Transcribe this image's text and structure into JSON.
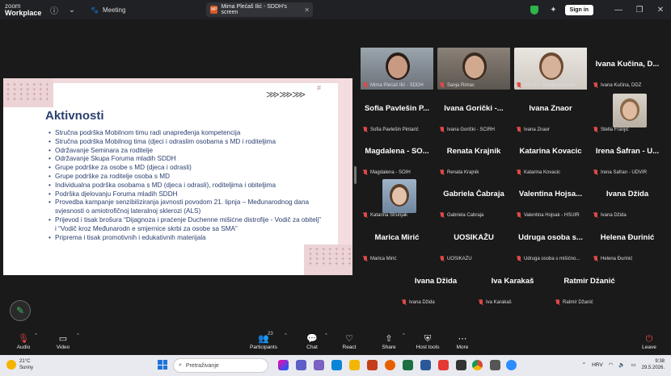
{
  "titlebar": {
    "logo_line1": "zoom",
    "logo_line2": "Workplace",
    "meeting_tab": "Meeting",
    "share_tab_badge": "MP",
    "share_tab_title": "Mima Plećaš Ilić - SDDH's screen",
    "signin": "Sign in"
  },
  "slide": {
    "title": "Aktivnosti",
    "arrows": "⋙⋙⋙",
    "items": [
      "Stručna podrška Mobilnom timu radi unapređenja kompetencija",
      "Stručna podrška Mobilnog tima (djeci i odraslim osobama s MD i roditeljima",
      "Održavanje Seminara za roditelje",
      "Održavanje Skupa Foruma mladih SDDH",
      "Grupe podrške za osobe s MD (djeca i odrasli)",
      "Grupe podrške za roditelje osoba s MD",
      "Individualna podrška osobama s MD (djeca i odrasli), roditeljima i obiteljima",
      "Podrška djelovanju Foruma mladih SDDH",
      "Provedba kampanje senzibiliziranja javnosti povodom 21. lipnja – Međunarodnog dana svjesnosti o amiotrofičnoj lateralnoj sklerozi (ALS)",
      "Prijevod i tisak brošura “Dijagnoza i praćenje Duchenne mišićne distrofije - Vodič za obitelj” i “Vodič kroz Međunarodn e smjernice skrbi za osobe sa SMA”",
      "Priprema i tisak promotivnih i edukativnih materijala"
    ]
  },
  "participants": [
    {
      "big": "",
      "caption": "Mima Plećaš Ilić - SDDH",
      "video": true
    },
    {
      "big": "",
      "caption": "Sanja Rimac",
      "video": true
    },
    {
      "big": "",
      "caption": "HSUTI - Marijana Borac",
      "video": true
    },
    {
      "big": "Ivana Kučina, D...",
      "caption": "Ivana Kučina, DDZ",
      "video": false
    },
    {
      "big": "Sofia Pavlešin P...",
      "caption": "Sofia Pavlešin Pintarić",
      "video": false
    },
    {
      "big": "Ivana Gorički -...",
      "caption": "Ivana Gorički - SCIRH",
      "video": false
    },
    {
      "big": "Ivana Znaor",
      "caption": "Ivana Znaor",
      "video": false
    },
    {
      "big": "",
      "caption": "Stella Franjić",
      "video": true
    },
    {
      "big": "Magdalena - SO...",
      "caption": "Magdalena - SOIH",
      "video": false
    },
    {
      "big": "Renata Krajnik",
      "caption": "Renata Krajnik",
      "video": false
    },
    {
      "big": "Katarina Kovacic",
      "caption": "Katarina Kovacic",
      "video": false
    },
    {
      "big": "Irena Šafran - U...",
      "caption": "Irena Šafran - UDVIR",
      "video": false
    },
    {
      "big": "",
      "caption": "Katarina Strunjak",
      "video": true
    },
    {
      "big": "Gabriela Čabraja",
      "caption": "Gabriela Čabraja",
      "video": false
    },
    {
      "big": "Valentina Hojsa...",
      "caption": "Valentina Hojsak - HSUIR",
      "video": false
    },
    {
      "big": "Ivana Džida",
      "caption": "Ivana Džida",
      "video": false
    },
    {
      "big": "Marica Mirić",
      "caption": "Marica Mirić",
      "video": false
    },
    {
      "big": "UOSIKAŽU",
      "caption": "UOSIKAŽU",
      "video": false
    },
    {
      "big": "Udruga osoba s...",
      "caption": "Udruga osoba s mišićno...",
      "video": false
    },
    {
      "big": "Helena Đurinić",
      "caption": "Helena Đurinić",
      "video": false
    },
    {
      "big": "Ivana Džida",
      "caption": "Ivana Džida",
      "video": false
    },
    {
      "big": "Iva Karakaš",
      "caption": "Iva Karakaš",
      "video": false
    },
    {
      "big": "Ratmir Džanić",
      "caption": "Ratmir Džanić",
      "video": false
    }
  ],
  "toolbar": {
    "audio": "Audio",
    "video": "Video",
    "participants": "Participants",
    "participants_count": "23",
    "chat": "Chat",
    "react": "React",
    "share": "Share",
    "host_tools": "Host tools",
    "more": "More",
    "leave": "Leave"
  },
  "taskbar": {
    "temp": "21°C",
    "weather": "Sunny",
    "search_placeholder": "Pretraživanje",
    "lang": "HRV",
    "time": "9:38",
    "date": "29.5.2026."
  },
  "colors": {
    "accent_green": "#2fb34a",
    "mute_red": "#e04848",
    "slide_navy": "#2a3f6f",
    "slide_pink": "#ecd3d6"
  }
}
